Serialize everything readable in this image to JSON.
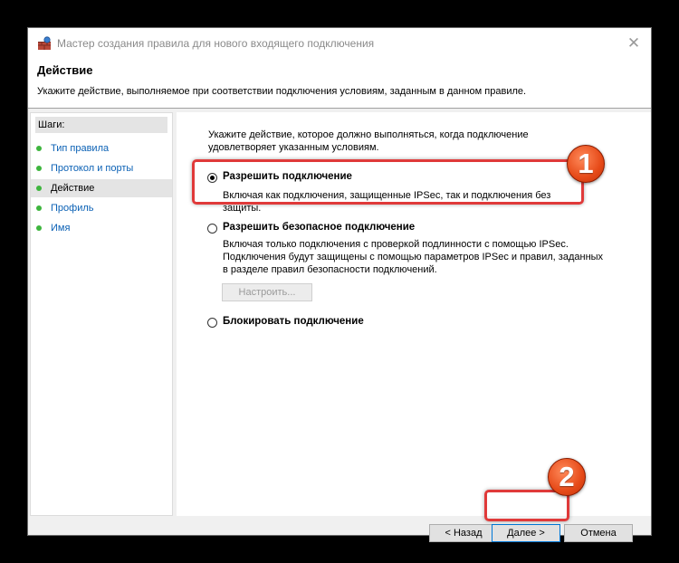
{
  "window": {
    "title": "Мастер создания правила для нового входящего подключения",
    "close_symbol": "✕"
  },
  "header": {
    "heading": "Действие",
    "subheading": "Укажите действие, выполняемое при соответствии подключения условиям, заданным в данном правиле."
  },
  "sidebar": {
    "title": "Шаги:",
    "items": [
      {
        "label": "Тип правила",
        "active": false
      },
      {
        "label": "Протокол и порты",
        "active": false
      },
      {
        "label": "Действие",
        "active": true
      },
      {
        "label": "Профиль",
        "active": false
      },
      {
        "label": "Имя",
        "active": false
      }
    ]
  },
  "main": {
    "intro": "Укажите действие, которое должно выполняться, когда подключение удовлетворяет указанным условиям.",
    "options": [
      {
        "label": "Разрешить подключение",
        "description": "Включая как подключения, защищенные IPSec, так и подключения без защиты.",
        "checked": true
      },
      {
        "label": "Разрешить безопасное подключение",
        "description": "Включая только подключения с проверкой подлинности с помощью IPSec. Подключения будут защищены с помощью параметров IPSec и правил, заданных в разделе правил безопасности подключений.",
        "checked": false
      },
      {
        "label": "Блокировать подключение",
        "description": "",
        "checked": false
      }
    ],
    "configure_button": "Настроить..."
  },
  "footer": {
    "back": "< Назад",
    "next": "Далее >",
    "cancel": "Отмена"
  },
  "annotations": {
    "badge1": "1",
    "badge2": "2",
    "highlight_color": "#e03a3a",
    "badge_color": "#e64a18"
  },
  "icons": {
    "app": "firewall-shield-icon",
    "close": "close-icon",
    "step_bullet": "green-dot-icon"
  }
}
